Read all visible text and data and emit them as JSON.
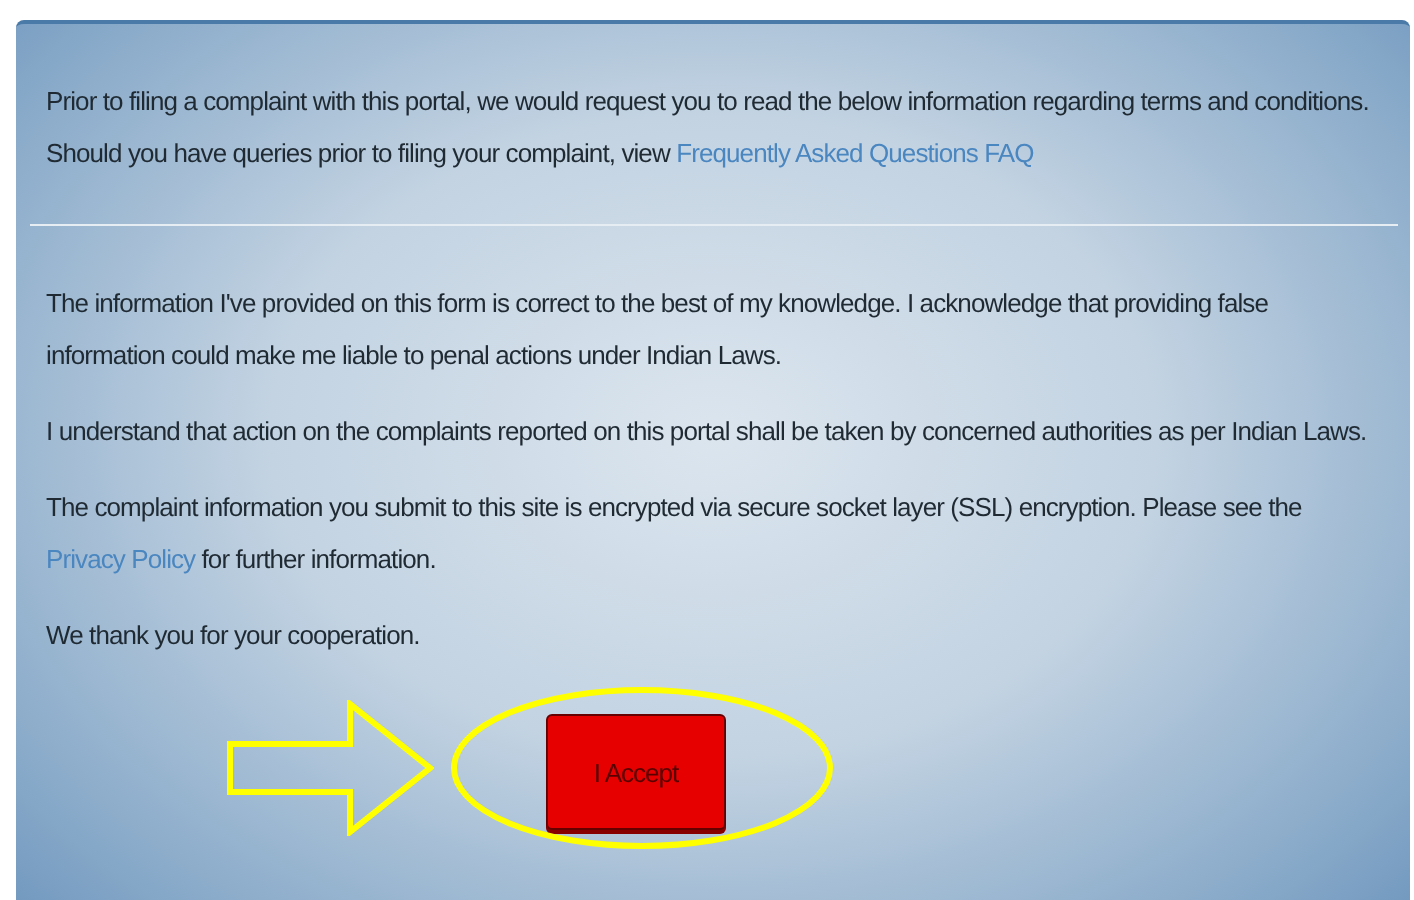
{
  "intro": {
    "before": "Prior to filing a complaint with this portal, we would request you to read the below information regarding terms and conditions. Should you have queries prior to filing your complaint, view ",
    "link": "Frequently Asked Questions FAQ"
  },
  "paragraphs": [
    {
      "before": "The information I've provided on this form is correct to the best of my knowledge. I acknowledge that providing false information could make me liable to penal actions under Indian Laws."
    },
    {
      "before": "I understand that action on the complaints reported on this portal shall be taken by concerned authorities as per Indian Laws."
    },
    {
      "before": "The complaint information you submit to this site is encrypted via secure socket layer (SSL) encryption. Please see the ",
      "link": "Privacy Policy",
      "after": " for further information."
    },
    {
      "before": "We thank you for your cooperation."
    }
  ],
  "accept_button": "I Accept"
}
